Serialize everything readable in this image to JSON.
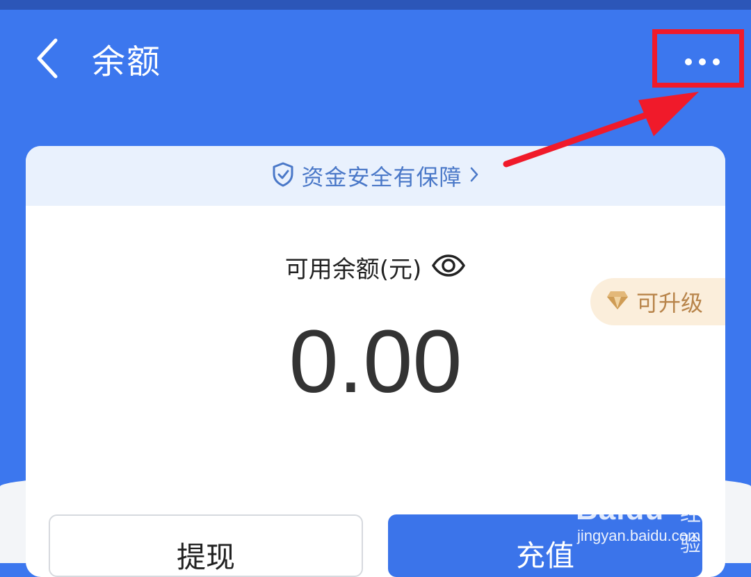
{
  "header": {
    "title": "余额",
    "back_icon": "chevron-left-icon",
    "more_icon": "more-horizontal-icon"
  },
  "card": {
    "safety_notice": "资金安全有保障",
    "balance_label": "可用余额(元)",
    "balance_value": "0.00",
    "upgrade_badge": "可升级"
  },
  "actions": {
    "withdraw_label": "提现",
    "recharge_label": "充值"
  },
  "watermark": {
    "logo": "Baidu",
    "brand": "经验",
    "url": "jingyan.baidu.com"
  },
  "colors": {
    "header_blue": "#3c77ee",
    "annotation_red": "#f01a2a",
    "safety_text": "#4a78c8",
    "upgrade_gold": "#b8844a"
  }
}
